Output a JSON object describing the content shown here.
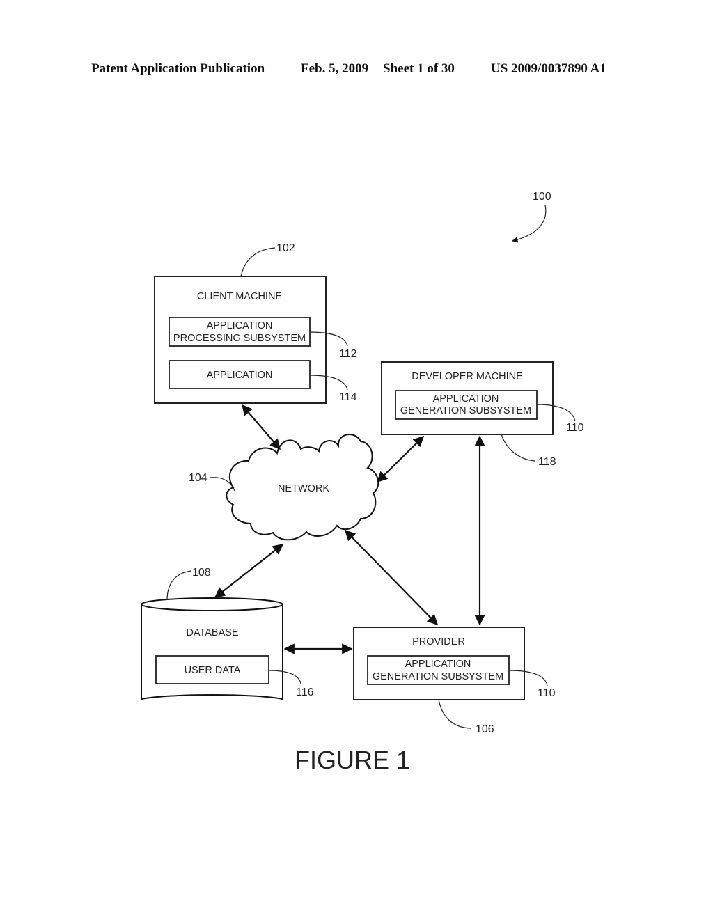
{
  "header": {
    "publication": "Patent Application Publication",
    "date": "Feb. 5, 2009",
    "sheet": "Sheet 1 of 30",
    "number": "US 2009/0037890 A1"
  },
  "figure": {
    "caption": "FIGURE 1",
    "system_ref": "100",
    "client_machine": {
      "title": "CLIENT MACHINE",
      "ref": "102",
      "subsystem_line1": "APPLICATION",
      "subsystem_line2": "PROCESSING SUBSYSTEM",
      "subsystem_ref": "112",
      "application": "APPLICATION",
      "application_ref": "114"
    },
    "network": {
      "title": "NETWORK",
      "ref": "104"
    },
    "developer_machine": {
      "title": "DEVELOPER MACHINE",
      "ref": "118",
      "subsystem_line1": "APPLICATION",
      "subsystem_line2": "GENERATION SUBSYSTEM",
      "subsystem_ref": "110"
    },
    "database": {
      "title": "DATABASE",
      "ref": "108",
      "user_data": "USER DATA",
      "user_data_ref": "116"
    },
    "provider": {
      "title": "PROVIDER",
      "ref": "106",
      "subsystem_line1": "APPLICATION",
      "subsystem_line2": "GENERATION SUBSYSTEM",
      "subsystem_ref": "110"
    },
    "connections": [
      {
        "from": "client_machine",
        "to": "network",
        "direction": "bidirectional"
      },
      {
        "from": "network",
        "to": "developer_machine",
        "direction": "bidirectional"
      },
      {
        "from": "network",
        "to": "database",
        "direction": "bidirectional"
      },
      {
        "from": "network",
        "to": "provider",
        "direction": "bidirectional"
      },
      {
        "from": "developer_machine",
        "to": "provider",
        "direction": "bidirectional"
      },
      {
        "from": "database",
        "to": "provider",
        "direction": "bidirectional"
      }
    ]
  }
}
